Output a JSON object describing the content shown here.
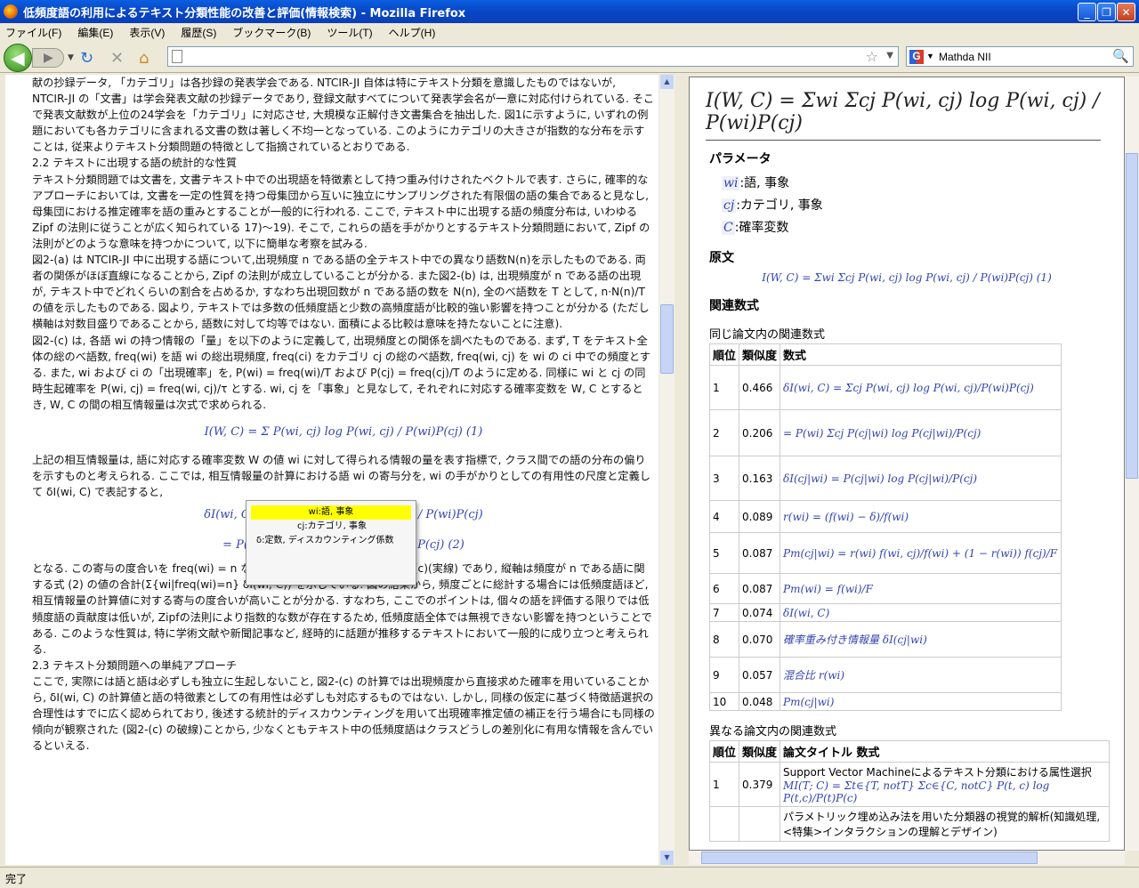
{
  "window": {
    "title": "低頻度語の利用によるテキスト分類性能の改善と評価(情報検索) - Mozilla Firefox"
  },
  "menu": [
    "ファイル(F)",
    "編集(E)",
    "表示(V)",
    "履歴(S)",
    "ブックマーク(B)",
    "ツール(T)",
    "ヘルプ(H)"
  ],
  "search": {
    "value": "Mathda NII"
  },
  "status": "完了",
  "left": {
    "paragraphs": [
      "献の抄録データ, 「カテゴリ」は各抄録の発表学会である. NTCIR-JI 自体は特にテキスト分類を意識したものではないが, NTCIR-JI の「文書」は学会発表文献の抄録データであり, 登録文献すべてについて発表学会名が一意に対応付けられている. そこで発表文献数が上位の24学会を「カテゴリ」に対応させ, 大規模な正解付き文書集合を抽出した. 図1に示すように, いずれの例題においても各カテゴリに含まれる文書の数は著しく不均一となっている. このようにカテゴリの大きさが指数的な分布を示すことは, 従来よりテキスト分類問題の特徴として指摘されているとおりである.",
      "2.2 テキストに出現する語の統計的な性質",
      "テキスト分類問題では文書を, 文書テキスト中での出現語を特徴素として持つ重み付けされたベクトルで表す. さらに, 確率的なアプローチにおいては, 文書を一定の性質を持つ母集団から互いに独立にサンプリングされた有限個の語の集合であると見なし, 母集団における推定確率を語の重みとすることが一般的に行われる. ここで, テキスト中に出現する語の頻度分布は, いわゆる Zipf の法則に従うことが広く知られている 17)〜19). そこで, これらの語を手がかりとするテキスト分類問題において, Zipf の法則がどのような意味を持つかについて, 以下に簡単な考察を試みる.",
      "図2-(a) は NTCIR-JI 中に出現する語について,出現頻度 n である語の全テキスト中での異なり語数N(n)を示したものである. 両者の関係がほぼ直線になることから, Zipf の法則が成立していることが分かる. また図2-(b) は, 出現頻度が n である語の出現が, テキスト中でどれくらいの割合を占めるか, すなわち出現回数が n である語の数を N(n), 全のべ語数を T として, n·N(n)/T の値を示したものである. 図より, テキストでは多数の低頻度語と少数の高頻度語が比較的強い影響を持つことが分かる (ただし横軸は対数目盛りであることから, 語数に対して均等ではない. 面積による比較は意味を持たないことに注意).",
      "図2-(c) は, 各語 wi の持つ情報の「量」を以下のように定義して, 出現頻度との関係を調べたものである. まず, T をテキスト全体の総のべ語数, freq(wi) を語 wi の総出現頻度, freq(ci) をカテゴリ cj の総のべ語数, freq(wi, cj) を wi の ci 中での頻度とする. また, wi および ci の「出現確率」を, P(wi) = freq(wi)/T および P(cj) = freq(cj)/T のように定める. 同様に wi と cj の同時生起確率を P(wi, cj) = freq(wi, cj)/τ とする. wi, cj を「事象」と見なして, それぞれに対応する確率変数を W, C とするとき, W, C の間の相互情報量は次式で求められる.",
      "上記の相互情報量は, 語に対応する確率変数 W の値 wi に対して得られる情報の量を表す指標で, クラス間での語の分布の偏りを示すものと考えられる. ここでは, 相互情報量の計算における語 wi の寄与分を, wi の手がかりとしての有用性の尺度と定義して δI(wi, C) で表記すると,",
      "となる. この寄与の度合いを freq(wi) = n なる語について集計したものが図2-(c)(実線) であり, 縦軸は頻度が n である語に関する式 (2) の値の合計(Σ{wi|freq(wi)=n} δI(wi, C)) を示している. 図の結果から, 頻度ごとに総計する場合には低頻度語ほど,相互情報量の計算値に対する寄与の度合いが高いことが分かる. すなわち, ここでのポイントは, 個々の語を評価する限りでは低頻度語の貢献度は低いが, Zipfの法則により指数的な数が存在するため, 低頻度語全体では無視できない影響を持つということである. このような性質は, 特に学術文献や新聞記事など, 経時的に話題が推移するテキストにおいて一般的に成り立つと考えられる.",
      "2.3 テキスト分類問題への単純アプローチ",
      "ここで, 実際には語と語は必ずしも独立に生起しないこと, 図2-(c) の計算では出現頻度から直接求めた確率を用いていることから, δI(wi, C) の計算値と語の特徴素としての有用性は必ずしも対応するものではない. しかし, 同様の仮定に基づく特徴語選択の合理性はすでに広く認められており, 後述する統計的ディスカウンティングを用いて出現確率推定値の補正を行う場合にも同様の傾向が観察された (図2-(c) の破線)ことから, 少なくともテキスト中の低頻度語はクラスどうしの差別化に有用な情報を含んでいるといえる."
    ],
    "equations": {
      "mi": "I(W, C) = Σ P(wi, cj) log P(wi, cj) / P(wi)P(cj)  (1)",
      "delta1": "δI(wi, C) = Σcj P(wi, cj) log P(wi, cj) / P(wi)P(cj)",
      "delta2": "= P(wi) Σcj P(cj|wi) log P(cj|wi) / P(cj)  (2)"
    },
    "tooltip": {
      "row1": "wi:語, 事象",
      "row2": "cj:カテゴリ, 事象",
      "row3": "δ:定数, ディスカウンティング係数"
    }
  },
  "right": {
    "formula": "I(W, C) = Σwi Σcj P(wi, cj) log P(wi, cj) / P(wi)P(cj)",
    "params_title": "パラメータ",
    "params": [
      {
        "sym": "wi",
        "desc": ":語, 事象"
      },
      {
        "sym": "cj",
        "desc": ":カテゴリ, 事象"
      },
      {
        "sym": "C",
        "desc": ":確率変数"
      }
    ],
    "orig_title": "原文",
    "orig": "I(W, C) = Σwi Σcj P(wi, cj) log P(wi, cj) / P(wi)P(cj)  (1)",
    "related_title": "関連数式",
    "same_title": "同じ論文内の関連数式",
    "same_headers": [
      "順位",
      "類似度",
      "数式"
    ],
    "same_rows": [
      [
        "1",
        "0.466",
        "δI(wi, C) = Σcj P(wi, cj) log P(wi, cj)/P(wi)P(cj)"
      ],
      [
        "2",
        "0.206",
        "= P(wi) Σcj P(cj|wi) log P(cj|wi)/P(cj)"
      ],
      [
        "3",
        "0.163",
        "δI(cj|wi) = P(cj|wi) log P(cj|wi)/P(cj)"
      ],
      [
        "4",
        "0.089",
        "r(wi) = (f(wi) − δ)/f(wi)"
      ],
      [
        "5",
        "0.087",
        "Pm(cj|wi) = r(wi) f(wi, cj)/f(wi) + (1 − r(wi)) f(cj)/F"
      ],
      [
        "6",
        "0.087",
        "Pm(wi) = f(wi)/F"
      ],
      [
        "7",
        "0.074",
        "δI(wi, C)"
      ],
      [
        "8",
        "0.070",
        "確率重み付き情報量 δI(cj|wi)"
      ],
      [
        "9",
        "0.057",
        "混合比 r(wi)"
      ],
      [
        "10",
        "0.048",
        "Pm(cj|wi)"
      ]
    ],
    "diff_title": "異なる論文内の関連数式",
    "diff_headers": [
      "順位",
      "類似度",
      "論文タイトル 数式"
    ],
    "diff_rows": [
      [
        "1",
        "0.379",
        "Support Vector Machineによるテキスト分類における属性選択",
        "MI(T; C) = Σt∈{T, notT} Σc∈{C, notC} P(t, c) log P(t,c)/P(t)P(c)"
      ],
      [
        "",
        "",
        "パラメトリック埋め込み法を用いた分類器の視覚的解析(知識処理, <特集>インタラクションの理解とデザイン)",
        ""
      ]
    ]
  }
}
